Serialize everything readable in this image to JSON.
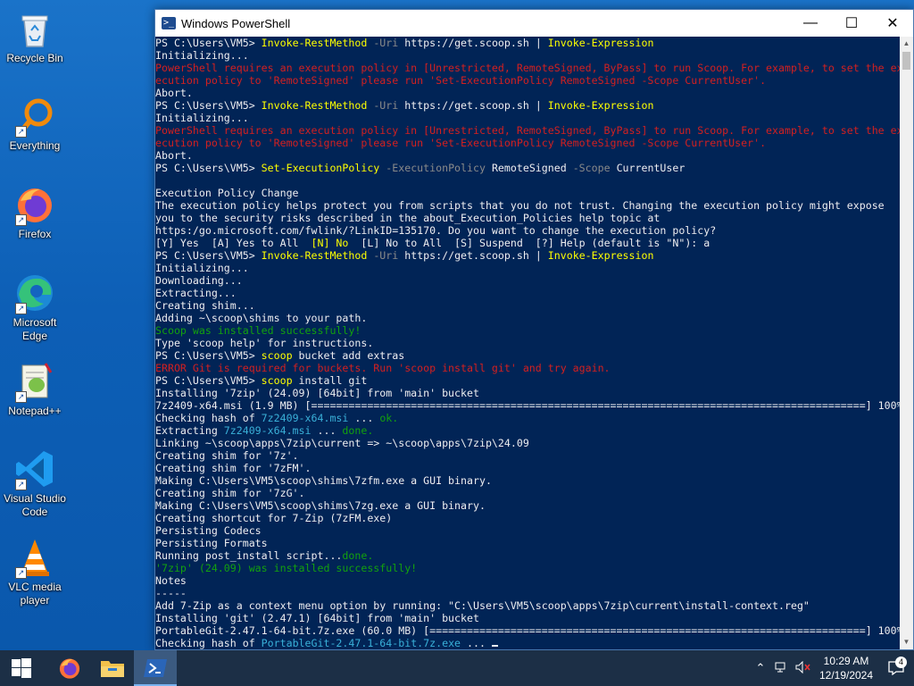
{
  "desktop": {
    "icons": [
      {
        "label": "Recycle Bin"
      },
      {
        "label": "Everything"
      },
      {
        "label": "Firefox"
      },
      {
        "label": "Microsoft Edge"
      },
      {
        "label": "Notepad++"
      },
      {
        "label": "Visual Studio Code"
      },
      {
        "label": "VLC media player"
      }
    ]
  },
  "window": {
    "title": "Windows PowerShell",
    "minimize_glyph": "—",
    "maximize_glyph": "☐",
    "close_glyph": "✕"
  },
  "console": {
    "lines": [
      [
        [
          "PS C:\\Users\\VM5> ",
          "w"
        ],
        [
          "Invoke-RestMethod",
          "y"
        ],
        [
          " -Uri ",
          "g"
        ],
        [
          "https://get.scoop.sh ",
          "w"
        ],
        [
          "| ",
          "w"
        ],
        [
          "Invoke-Expression",
          "y"
        ]
      ],
      [
        [
          "Initializing...",
          "w"
        ]
      ],
      [
        [
          "PowerShell requires an execution policy in [Unrestricted, RemoteSigned, ByPass] to run Scoop. For example, to set the ex",
          "err"
        ]
      ],
      [
        [
          "ecution policy to 'RemoteSigned' please run 'Set-ExecutionPolicy RemoteSigned -Scope CurrentUser'.",
          "err"
        ]
      ],
      [
        [
          "Abort.",
          "w"
        ]
      ],
      [
        [
          "PS C:\\Users\\VM5> ",
          "w"
        ],
        [
          "Invoke-RestMethod",
          "y"
        ],
        [
          " -Uri ",
          "g"
        ],
        [
          "https://get.scoop.sh ",
          "w"
        ],
        [
          "| ",
          "w"
        ],
        [
          "Invoke-Expression",
          "y"
        ]
      ],
      [
        [
          "Initializing...",
          "w"
        ]
      ],
      [
        [
          "PowerShell requires an execution policy in [Unrestricted, RemoteSigned, ByPass] to run Scoop. For example, to set the ex",
          "err"
        ]
      ],
      [
        [
          "ecution policy to 'RemoteSigned' please run 'Set-ExecutionPolicy RemoteSigned -Scope CurrentUser'.",
          "err"
        ]
      ],
      [
        [
          "Abort.",
          "w"
        ]
      ],
      [
        [
          "PS C:\\Users\\VM5> ",
          "w"
        ],
        [
          "Set-ExecutionPolicy",
          "y"
        ],
        [
          " -ExecutionPolicy ",
          "g"
        ],
        [
          "RemoteSigned ",
          "w"
        ],
        [
          "-Scope ",
          "g"
        ],
        [
          "CurrentUser",
          "w"
        ]
      ],
      [
        [
          "",
          "w"
        ]
      ],
      [
        [
          "Execution Policy Change",
          "w"
        ]
      ],
      [
        [
          "The execution policy helps protect you from scripts that you do not trust. Changing the execution policy might expose",
          "w"
        ]
      ],
      [
        [
          "you to the security risks described in the about_Execution_Policies help topic at",
          "w"
        ]
      ],
      [
        [
          "https:/go.microsoft.com/fwlink/?LinkID=135170. Do you want to change the execution policy?",
          "w"
        ]
      ],
      [
        [
          "[Y] Yes  [A] Yes to All  ",
          "w"
        ],
        [
          "[N] No",
          "yb"
        ],
        [
          "  [L] No to All  [S] Suspend  [?] Help (default is \"N\"): a",
          "w"
        ]
      ],
      [
        [
          "PS C:\\Users\\VM5> ",
          "w"
        ],
        [
          "Invoke-RestMethod",
          "y"
        ],
        [
          " -Uri ",
          "g"
        ],
        [
          "https://get.scoop.sh ",
          "w"
        ],
        [
          "| ",
          "w"
        ],
        [
          "Invoke-Expression",
          "y"
        ]
      ],
      [
        [
          "Initializing...",
          "w"
        ]
      ],
      [
        [
          "Downloading...",
          "w"
        ]
      ],
      [
        [
          "Extracting...",
          "w"
        ]
      ],
      [
        [
          "Creating shim...",
          "w"
        ]
      ],
      [
        [
          "Adding ~\\scoop\\shims to your path.",
          "w"
        ]
      ],
      [
        [
          "Scoop was installed successfully!",
          "grn"
        ]
      ],
      [
        [
          "Type 'scoop help' for instructions.",
          "w"
        ]
      ],
      [
        [
          "PS C:\\Users\\VM5> ",
          "w"
        ],
        [
          "scoop",
          "y"
        ],
        [
          " bucket add extras",
          "w"
        ]
      ],
      [
        [
          "ERROR Git is required for buckets. Run 'scoop install git' and try again.",
          "err"
        ]
      ],
      [
        [
          "PS C:\\Users\\VM5> ",
          "w"
        ],
        [
          "scoop",
          "y"
        ],
        [
          " install git",
          "w"
        ]
      ],
      [
        [
          "Installing '7zip' (24.09) [64bit] from 'main' bucket",
          "w"
        ]
      ],
      [
        [
          "7z2409-x64.msi (1.9 MB) [=========================================================================================] 100%",
          "w"
        ]
      ],
      [
        [
          "Checking hash of ",
          "w"
        ],
        [
          "7z2409-x64.msi",
          "cy"
        ],
        [
          " ... ",
          "w"
        ],
        [
          "ok.",
          "grn"
        ]
      ],
      [
        [
          "Extracting ",
          "w"
        ],
        [
          "7z2409-x64.msi",
          "cy"
        ],
        [
          " ... ",
          "w"
        ],
        [
          "done.",
          "grn"
        ]
      ],
      [
        [
          "Linking ~\\scoop\\apps\\7zip\\current => ~\\scoop\\apps\\7zip\\24.09",
          "w"
        ]
      ],
      [
        [
          "Creating shim for '7z'.",
          "w"
        ]
      ],
      [
        [
          "Creating shim for '7zFM'.",
          "w"
        ]
      ],
      [
        [
          "Making C:\\Users\\VM5\\scoop\\shims\\7zfm.exe a GUI binary.",
          "w"
        ]
      ],
      [
        [
          "Creating shim for '7zG'.",
          "w"
        ]
      ],
      [
        [
          "Making C:\\Users\\VM5\\scoop\\shims\\7zg.exe a GUI binary.",
          "w"
        ]
      ],
      [
        [
          "Creating shortcut for 7-Zip (7zFM.exe)",
          "w"
        ]
      ],
      [
        [
          "Persisting Codecs",
          "w"
        ]
      ],
      [
        [
          "Persisting Formats",
          "w"
        ]
      ],
      [
        [
          "Running post_install script...",
          "w"
        ],
        [
          "done.",
          "grn"
        ]
      ],
      [
        [
          "'7zip' (24.09) was installed successfully!",
          "grn"
        ]
      ],
      [
        [
          "Notes",
          "w"
        ]
      ],
      [
        [
          "-----",
          "w"
        ]
      ],
      [
        [
          "Add 7-Zip as a context menu option by running: \"C:\\Users\\VM5\\scoop\\apps\\7zip\\current\\install-context.reg\"",
          "w"
        ]
      ],
      [
        [
          "Installing 'git' (2.47.1) [64bit] from 'main' bucket",
          "w"
        ]
      ],
      [
        [
          "PortableGit-2.47.1-64-bit.7z.exe (60.0 MB) [======================================================================] 100%",
          "w"
        ]
      ],
      [
        [
          "Checking hash of ",
          "w"
        ],
        [
          "PortableGit-2.47.1-64-bit.7z.exe",
          "cy"
        ],
        [
          " ... ",
          "w"
        ]
      ]
    ]
  },
  "taskbar": {
    "apps": [
      {
        "name": "firefox"
      },
      {
        "name": "file-explorer"
      },
      {
        "name": "powershell",
        "active": true
      }
    ],
    "tray": {
      "time": "10:29 AM",
      "date": "12/19/2024",
      "notification_count": "4"
    }
  }
}
